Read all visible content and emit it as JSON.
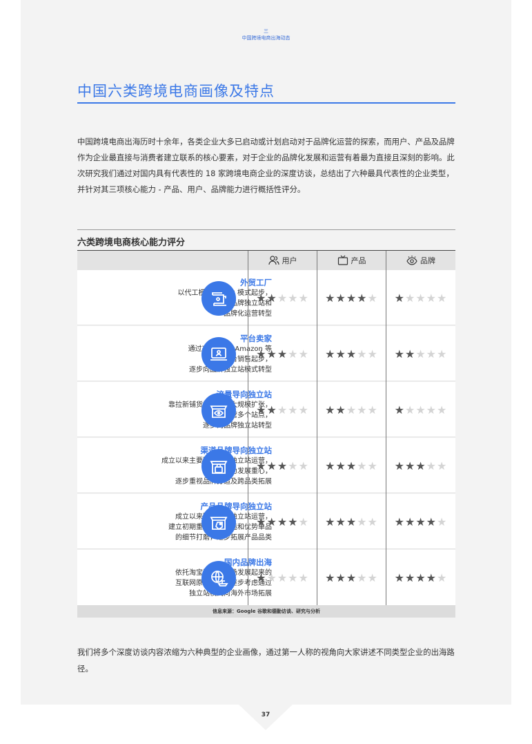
{
  "section": {
    "mark": "三",
    "label": "中国跨境电商出海动态"
  },
  "title": "中国六类跨境电商画像及特点",
  "intro": "中国跨境电商出海历时十余年，各类企业大多已启动或计划启动对于品牌化运营的探索，而用户、产品及品牌作为企业最直接与消费者建立联系的核心要素，对于企业的品牌化发展和运营有着最为直接且深刻的影响。此次研究我们通过对国内具有代表性的 18 家跨境电商企业的深度访谈，总结出了六种最具代表性的企业类型，并针对其三项核心能力 - 产品、用户、品牌能力进行概括性评分。",
  "table": {
    "title": "六类跨境电商核心能力评分",
    "columns": [
      {
        "label": "用户",
        "icon": "users-icon"
      },
      {
        "label": "产品",
        "icon": "tv-icon"
      },
      {
        "label": "品牌",
        "icon": "eye-icon"
      }
    ],
    "rows": [
      {
        "name": "外贸工厂",
        "lines": [
          "以代工模式或 B2B 模式起步，",
          "逐步向品牌独立站和",
          "品牌化运营转型"
        ],
        "icon": "sewing-machine-icon",
        "ratings": [
          2,
          4,
          1
        ]
      },
      {
        "name": "平台卖家",
        "lines": [
          "通过在 ebay、Amazon 等",
          "第三方平台销售起步，",
          "逐步向品牌独立站模式转型"
        ],
        "icon": "laptop-user-icon",
        "ratings": [
          3,
          3,
          2
        ]
      },
      {
        "name": "流量导向独立站",
        "lines": [
          "靠拉新铺货模式快速大规模扩张，",
          "运营多个站点，",
          "逐步向品牌独立站转型"
        ],
        "icon": "store-eye-icon",
        "ratings": [
          2,
          2,
          1
        ]
      },
      {
        "name": "渠道品牌导向独立站",
        "lines": [
          "成立以来主要围绕单个独立站运营，",
          "以产品为发展重心，",
          "逐步重视品牌打造及跨品类拓展"
        ],
        "icon": "store-bag-icon",
        "ratings": [
          3,
          3,
          3
        ]
      },
      {
        "name": "产品品牌导向独立站",
        "lines": [
          "成立以来围绕单个独立站运营，",
          "建立初期重视品牌打造和优势单品",
          "的细节打磨，逐步拓展产品品类"
        ],
        "icon": "store-tag-icon",
        "ratings": [
          4,
          3,
          4
        ]
      },
      {
        "name": "国内品牌出海",
        "lines": [
          "依托淘宝及国内市场发展起来的",
          "互联网原生品牌，逐步考虑通过",
          "独立站模式向海外市场拓展"
        ],
        "icon": "globe-ship-icon",
        "ratings": [
          1,
          3,
          4
        ]
      }
    ],
    "max_stars": 5,
    "source": "信息来源：Google 谷歌和德勤访谈、研究与分析"
  },
  "outro": "我们将多个深度访谈内容浓缩为六种典型的企业画像，通过第一人称的视角向大家讲述不同类型企业的出海路径。",
  "page_number": "37",
  "colors": {
    "accent": "#3b78e7",
    "star_on": "#555555",
    "star_off": "#d4d4d4"
  }
}
